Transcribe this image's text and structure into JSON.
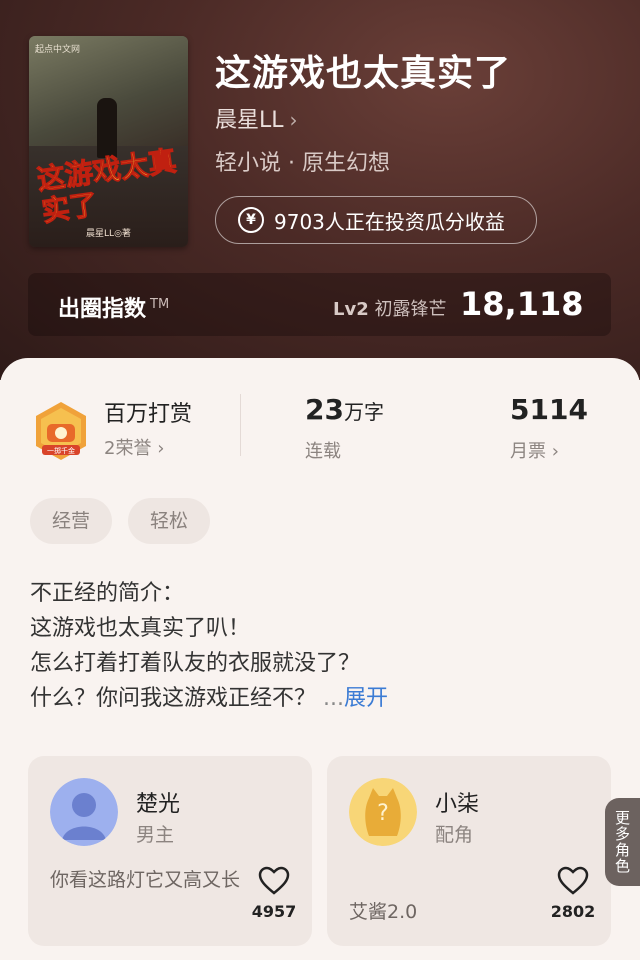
{
  "book": {
    "title": "这游戏也太真实了",
    "author": "晨星LL",
    "author_chevron": "›",
    "genre": "轻小说 · 原生幻想",
    "invest_icon": "¥",
    "invest_text": "9703人正在投资瓜分收益",
    "cover": {
      "publisher": "起点中文网",
      "title": "这游戏太真实了",
      "author": "晨星LL◎著"
    }
  },
  "index": {
    "label": "出圈指数",
    "trademark": "TM",
    "level": "Lv2",
    "level_name": "初露锋芒",
    "value": "18,118",
    "chevron": "›"
  },
  "stats": {
    "reward": {
      "title": "百万打赏",
      "sub": "2荣誉",
      "chevron": "›",
      "badge_text": "一掷千金"
    },
    "words": {
      "value": "23",
      "unit": "万字",
      "sub": "连载"
    },
    "tickets": {
      "value": "5114",
      "sub": "月票",
      "chevron": "›"
    }
  },
  "tags": [
    "经营",
    "轻松"
  ],
  "intro": {
    "lines": [
      "不正经的简介：",
      "这游戏也太真实了叭！",
      "怎么打着打着队友的衣服就没了？",
      "什么？你问我这游戏正经不？"
    ],
    "ellipsis": "...",
    "expand": "展开"
  },
  "characters": [
    {
      "name": "楚光",
      "role": "男主",
      "quote": "你看这路灯它又高又长",
      "likes": "4957",
      "avatar_color": "#8fa6e6"
    },
    {
      "name": "小柒",
      "role": "配角",
      "quote": "艾酱2.0",
      "likes": "2802",
      "avatar_color": "#f4c95a"
    }
  ],
  "more_roles": "更多角色",
  "colors": {
    "accent_link": "#3b7bd4",
    "hero_bg": "#4b2a26",
    "panel_bg": "#f9f3f0"
  }
}
